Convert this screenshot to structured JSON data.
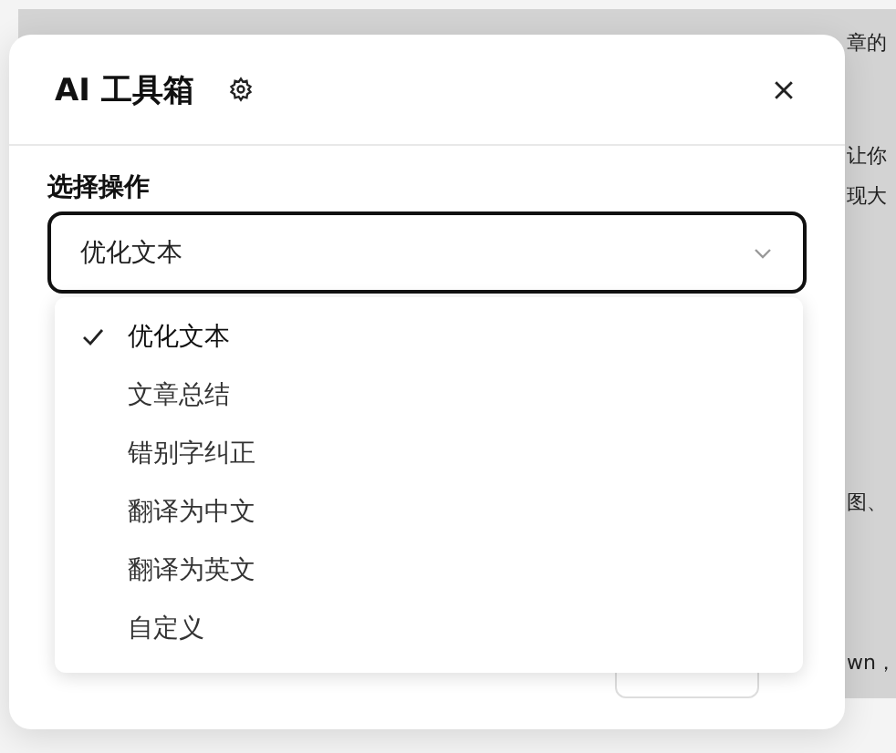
{
  "background_page": {
    "fragments": [
      "章的",
      "让你",
      "现大",
      "图、",
      "wn，"
    ]
  },
  "dialog": {
    "title": "AI 工具箱",
    "field": {
      "label": "选择操作",
      "value": "优化文本",
      "expanded": true
    },
    "options": [
      {
        "label": "优化文本",
        "selected": true
      },
      {
        "label": "文章总结",
        "selected": false
      },
      {
        "label": "错别字纠正",
        "selected": false
      },
      {
        "label": "翻译为中文",
        "selected": false
      },
      {
        "label": "翻译为英文",
        "selected": false
      },
      {
        "label": "自定义",
        "selected": false
      }
    ]
  }
}
